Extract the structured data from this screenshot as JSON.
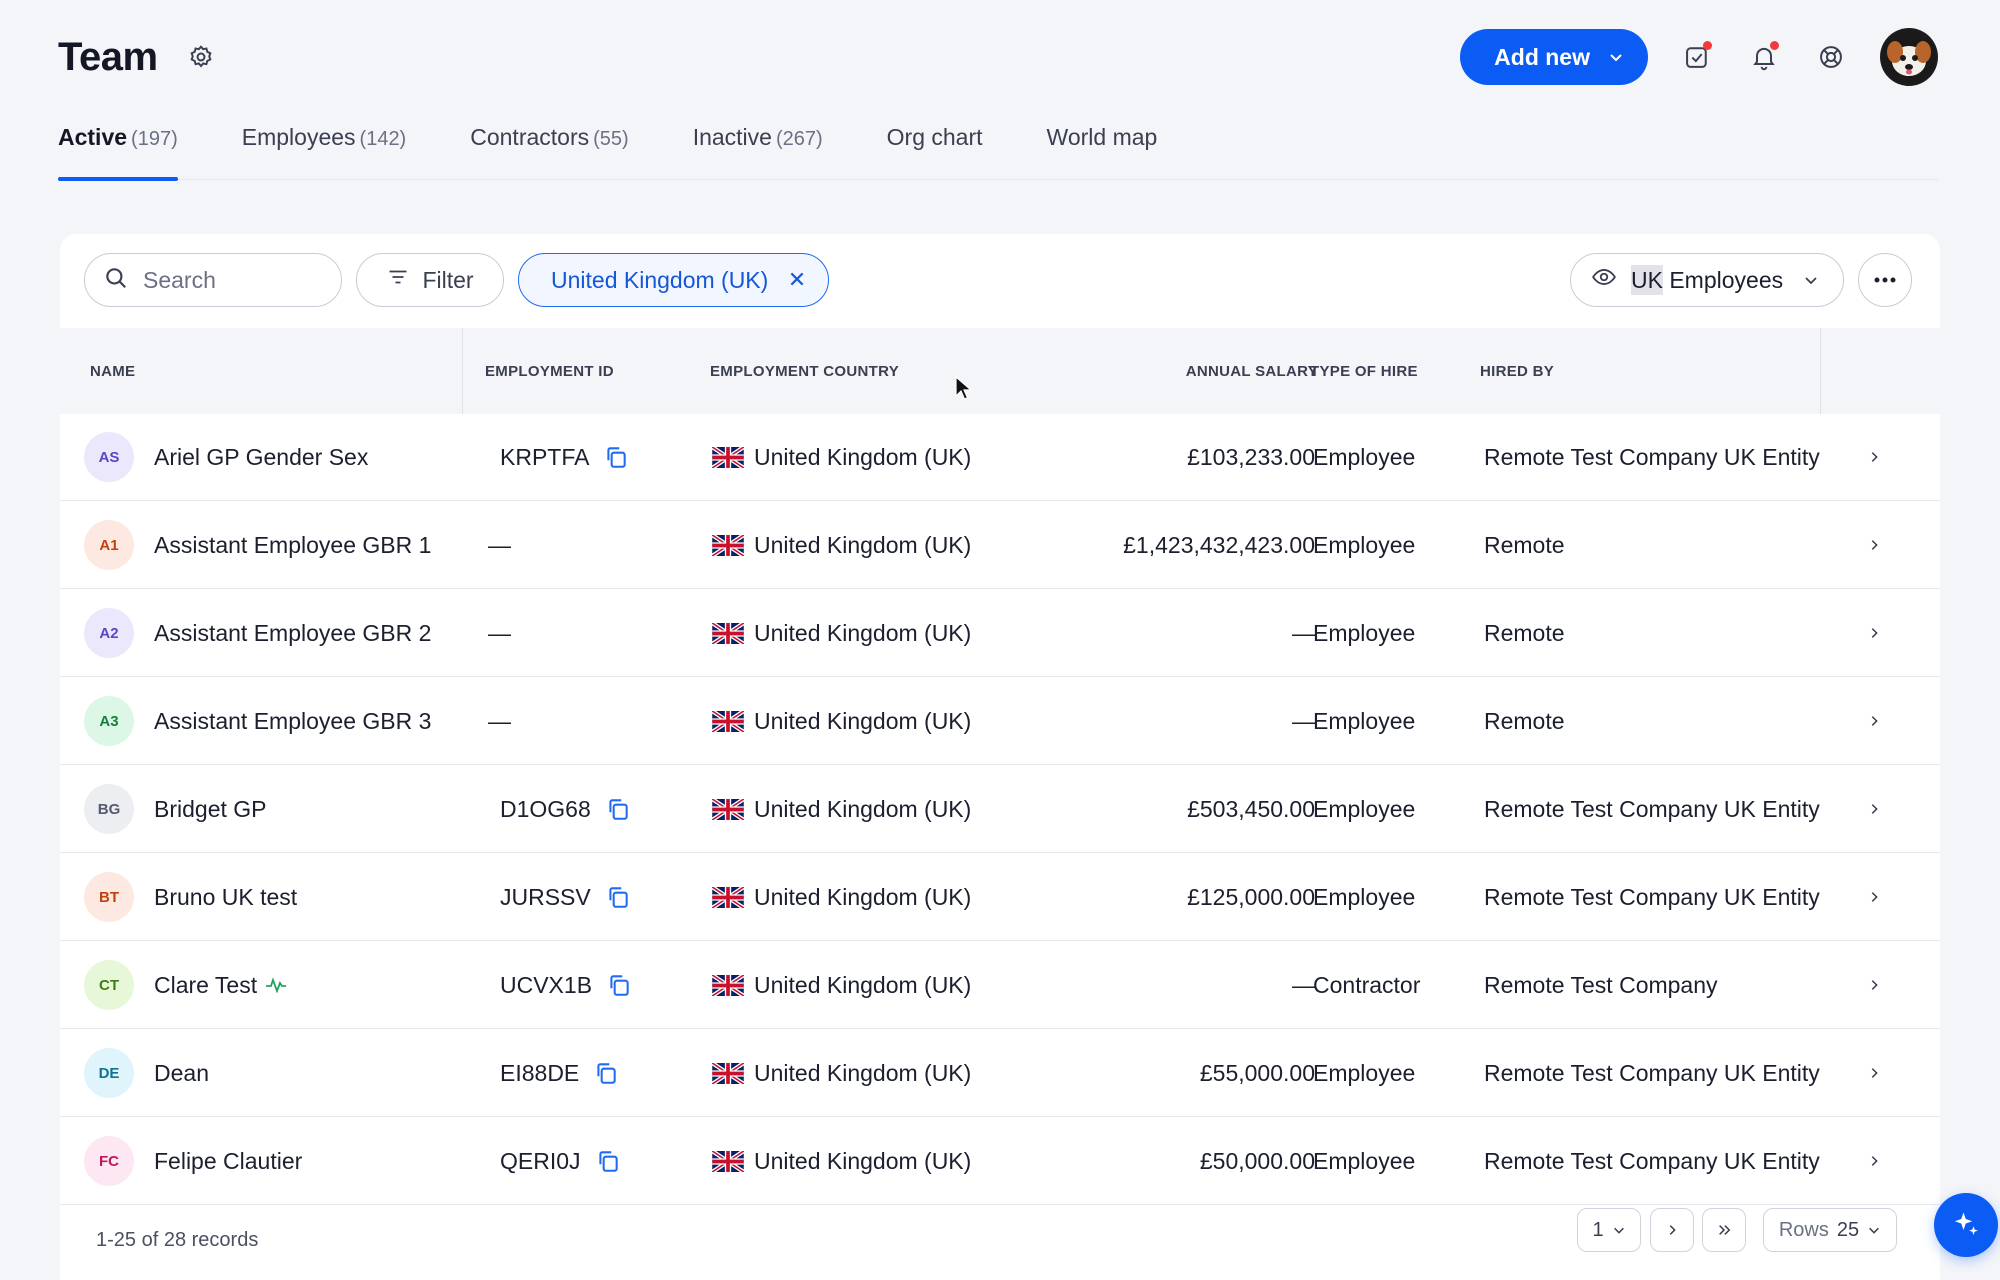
{
  "header": {
    "title": "Team",
    "add_new_label": "Add new"
  },
  "tabs": [
    {
      "label": "Active",
      "count": "(197)",
      "active": true
    },
    {
      "label": "Employees",
      "count": "(142)"
    },
    {
      "label": "Contractors",
      "count": "(55)"
    },
    {
      "label": "Inactive",
      "count": "(267)"
    },
    {
      "label": "Org chart",
      "count": ""
    },
    {
      "label": "World map",
      "count": ""
    }
  ],
  "toolbar": {
    "search_placeholder": "Search",
    "filter_label": "Filter",
    "active_filter": "United Kingdom (UK)",
    "view_prefix": "UK",
    "view_suffix": " Employees"
  },
  "table": {
    "columns": [
      "NAME",
      "EMPLOYMENT ID",
      "EMPLOYMENT COUNTRY",
      "ANNUAL SALARY",
      "TYPE OF HIRE",
      "HIRED BY"
    ],
    "rows": [
      {
        "initials": "AS",
        "name": "Ariel GP Gender Sex",
        "emp_id": "KRPTFA",
        "country": "United Kingdom (UK)",
        "salary": "£103,233.00",
        "type": "Employee",
        "hired_by": "Remote Test Company UK Entity",
        "avatar_bg": "#ece8fb",
        "avatar_fg": "#5b46c4"
      },
      {
        "initials": "A1",
        "name": "Assistant Employee GBR 1",
        "emp_id": "—",
        "country": "United Kingdom (UK)",
        "salary": "£1,423,432,423.00",
        "type": "Employee",
        "hired_by": "Remote",
        "avatar_bg": "#fde9e1",
        "avatar_fg": "#c2410c"
      },
      {
        "initials": "A2",
        "name": "Assistant Employee GBR 2",
        "emp_id": "—",
        "country": "United Kingdom (UK)",
        "salary": "—",
        "type": "Employee",
        "hired_by": "Remote",
        "avatar_bg": "#ece8fb",
        "avatar_fg": "#5b46c4"
      },
      {
        "initials": "A3",
        "name": "Assistant Employee GBR 3",
        "emp_id": "—",
        "country": "United Kingdom (UK)",
        "salary": "—",
        "type": "Employee",
        "hired_by": "Remote",
        "avatar_bg": "#dcf7e6",
        "avatar_fg": "#15803d"
      },
      {
        "initials": "BG",
        "name": "Bridget GP",
        "emp_id": "D1OG68",
        "country": "United Kingdom (UK)",
        "salary": "£503,450.00",
        "type": "Employee",
        "hired_by": "Remote Test Company UK Entity",
        "avatar_bg": "#eceef2",
        "avatar_fg": "#555b6e"
      },
      {
        "initials": "BT",
        "name": "Bruno UK test",
        "emp_id": "JURSSV",
        "country": "United Kingdom (UK)",
        "salary": "£125,000.00",
        "type": "Employee",
        "hired_by": "Remote Test Company UK Entity",
        "avatar_bg": "#fde9e1",
        "avatar_fg": "#c2410c"
      },
      {
        "initials": "CT",
        "name": "Clare Test",
        "emp_id": "UCVX1B",
        "country": "United Kingdom (UK)",
        "salary": "—",
        "type": "Contractor",
        "hired_by": "Remote Test Company",
        "avatar_bg": "#e7f8d9",
        "avatar_fg": "#3f7d12",
        "activity": true
      },
      {
        "initials": "DE",
        "name": "Dean",
        "emp_id": "EI88DE",
        "country": "United Kingdom (UK)",
        "salary": "£55,000.00",
        "type": "Employee",
        "hired_by": "Remote Test Company UK Entity",
        "avatar_bg": "#dff4fb",
        "avatar_fg": "#0e7490"
      },
      {
        "initials": "FC",
        "name": "Felipe Clautier",
        "emp_id": "QERI0J",
        "country": "United Kingdom (UK)",
        "salary": "£50,000.00",
        "type": "Employee",
        "hired_by": "Remote Test Company UK Entity",
        "avatar_bg": "#fde7f3",
        "avatar_fg": "#be185d"
      }
    ]
  },
  "footer": {
    "records_text": "1-25 of 28 records",
    "page": "1",
    "rows_label": "Rows",
    "rows_value": "25"
  },
  "icons": [
    "gear-icon",
    "chevron-down-icon",
    "task-check-icon",
    "bell-icon",
    "help-lifebuoy-icon",
    "search-icon",
    "filter-icon",
    "close-icon",
    "eye-icon",
    "more-icon",
    "copy-icon",
    "uk-flag-icon",
    "chevron-right-icon",
    "activity-icon",
    "sparkle-icon"
  ],
  "colors": {
    "accent": "#0a5cf5",
    "notification_dot": "#f23a3a"
  }
}
